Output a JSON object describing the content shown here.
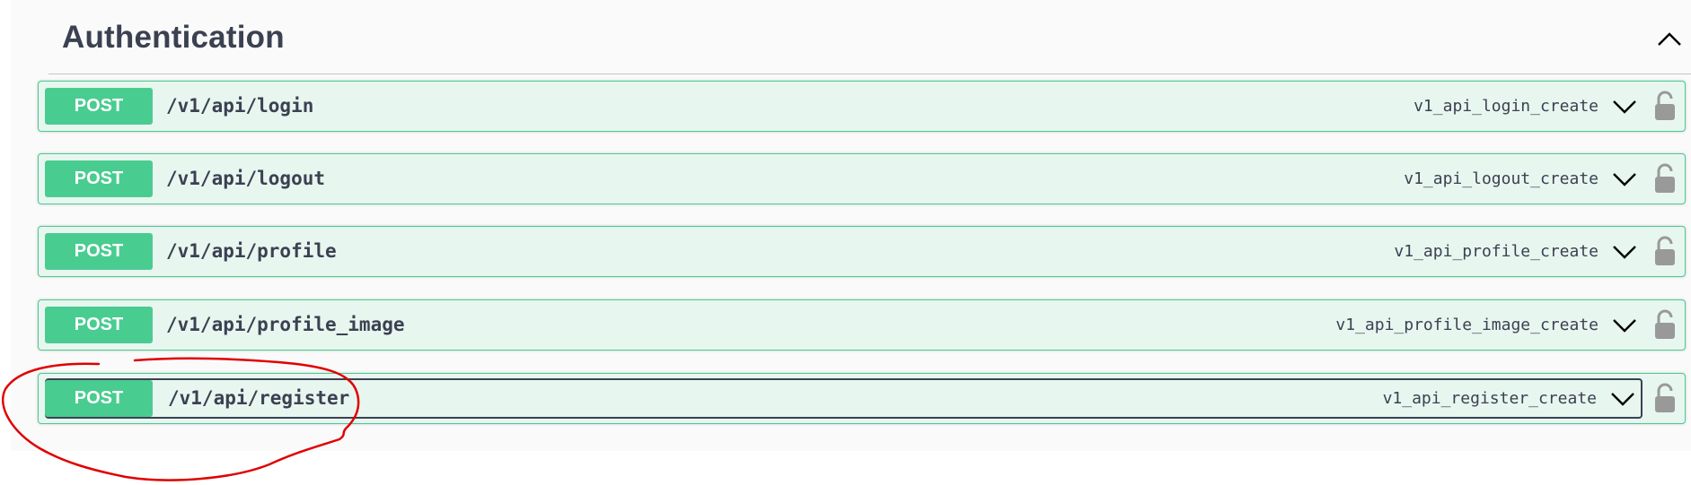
{
  "tag": {
    "title": "Authentication",
    "collapse_icon": "chevron-up-icon"
  },
  "colors": {
    "post": "#49cc90",
    "post_bg": "#e8f6f0",
    "text": "#3b4151",
    "annotation": "#e00000"
  },
  "operations": [
    {
      "method": "POST",
      "path": "/v1/api/login",
      "operation_id": "v1_api_login_create",
      "expand_icon": "chevron-down-icon",
      "lock_icon": "lock-icon"
    },
    {
      "method": "POST",
      "path": "/v1/api/logout",
      "operation_id": "v1_api_logout_create",
      "expand_icon": "chevron-down-icon",
      "lock_icon": "lock-icon"
    },
    {
      "method": "POST",
      "path": "/v1/api/profile",
      "operation_id": "v1_api_profile_create",
      "expand_icon": "chevron-down-icon",
      "lock_icon": "lock-icon"
    },
    {
      "method": "POST",
      "path": "/v1/api/profile_image",
      "operation_id": "v1_api_profile_image_create",
      "expand_icon": "chevron-down-icon",
      "lock_icon": "lock-icon"
    },
    {
      "method": "POST",
      "path": "/v1/api/register",
      "operation_id": "v1_api_register_create",
      "expand_icon": "chevron-down-icon",
      "lock_icon": "lock-icon",
      "focused": true
    }
  ]
}
